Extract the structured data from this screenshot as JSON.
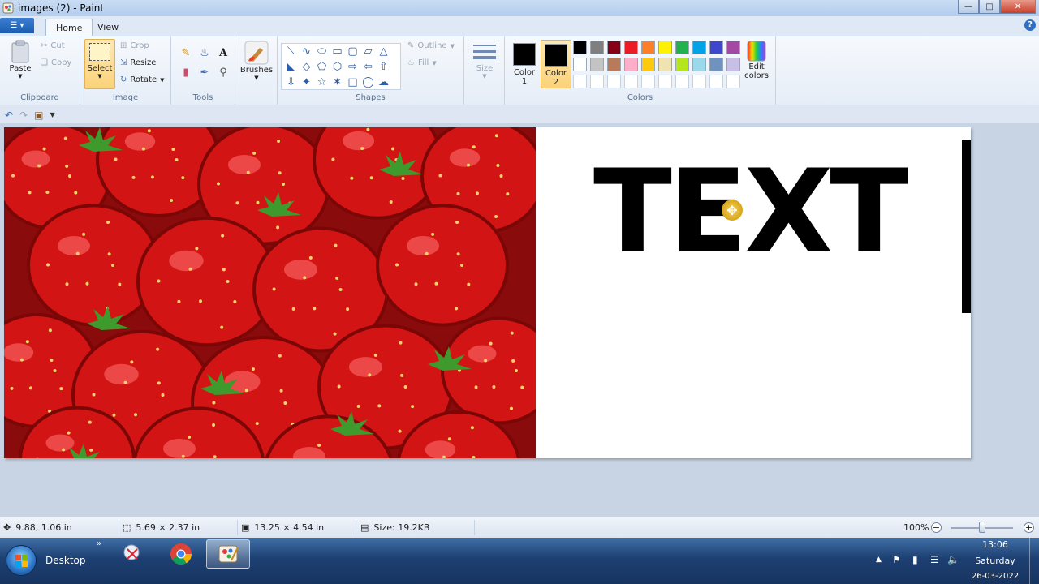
{
  "window": {
    "title": "images (2) - Paint"
  },
  "tabs": {
    "home": "Home",
    "view": "View"
  },
  "ribbon": {
    "clipboard": {
      "label": "Clipboard",
      "paste": "Paste",
      "cut": "Cut",
      "copy": "Copy"
    },
    "image": {
      "label": "Image",
      "select": "Select",
      "crop": "Crop",
      "resize": "Resize",
      "rotate": "Rotate"
    },
    "tools": {
      "label": "Tools"
    },
    "brushes": {
      "label": "Brushes"
    },
    "shapes": {
      "label": "Shapes",
      "outline": "Outline",
      "fill": "Fill"
    },
    "size": {
      "label": "Size"
    },
    "colors": {
      "label": "Colors",
      "color1": "Color",
      "color1_num": "1",
      "color2": "Color",
      "color2_num": "2",
      "edit_colors": "Edit",
      "edit_colors_2": "colors",
      "palette": [
        "#000000",
        "#7f7f7f",
        "#880015",
        "#ed1c24",
        "#ff7f27",
        "#fff200",
        "#22b14c",
        "#00a2e8",
        "#3f48cc",
        "#a349a4",
        "#ffffff",
        "#c3c3c3",
        "#b97a57",
        "#ffaec9",
        "#ffc90e",
        "#efe4b0",
        "#b5e61d",
        "#99d9ea",
        "#7092be",
        "#c8bfe7",
        "#ffffff",
        "#ffffff",
        "#ffffff",
        "#ffffff",
        "#ffffff",
        "#ffffff",
        "#ffffff",
        "#ffffff",
        "#ffffff",
        "#ffffff"
      ]
    }
  },
  "canvas": {
    "text": "TEXT"
  },
  "status": {
    "cursor_pos": "9.88, 1.06 in",
    "selection_size": "5.69 × 2.37 in",
    "image_size": "13.25 × 4.54 in",
    "file_size": "Size: 19.2KB",
    "zoom": "100%"
  },
  "taskbar": {
    "desktop": "Desktop",
    "time": "13:06",
    "day": "Saturday",
    "date": "26-03-2022"
  }
}
